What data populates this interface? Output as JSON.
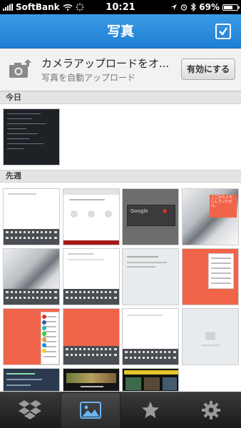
{
  "status_bar": {
    "carrier": "SoftBank",
    "time": "10:21",
    "battery": "69%",
    "battery_level": 0.69
  },
  "navbar": {
    "title": "写真"
  },
  "upload_banner": {
    "title": "カメラアップロードをオ...",
    "subtitle": "写真を自動アップロード",
    "button_label": "有効にする"
  },
  "sections": {
    "today": "今日",
    "last_week": "先週"
  },
  "thumbnails_text": {
    "memo_note": "ここからメモ\nにしていただ\nけ。",
    "google_label": "Google"
  },
  "tabs": [
    {
      "name": "dropbox",
      "icon": "dropbox-icon"
    },
    {
      "name": "photos",
      "icon": "photos-icon"
    },
    {
      "name": "favorites",
      "icon": "star-icon"
    },
    {
      "name": "settings",
      "icon": "gear-icon"
    }
  ],
  "colors": {
    "navbar_blue": "#2589dc",
    "accent_red": "#f06449"
  }
}
